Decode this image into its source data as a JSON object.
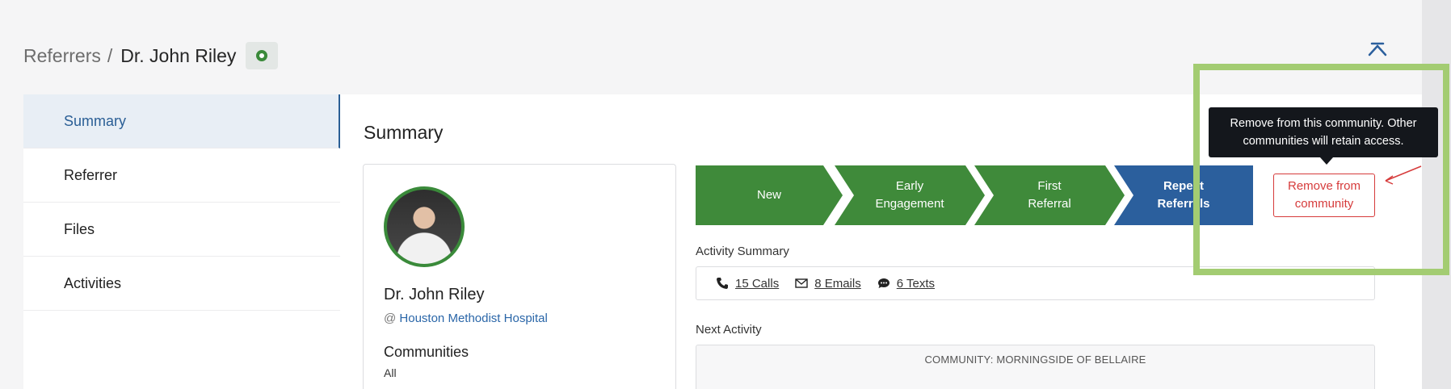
{
  "breadcrumb": {
    "parent": "Referrers",
    "separator": "/",
    "current": "Dr. John Riley"
  },
  "status": {
    "color": "#3a8a3a"
  },
  "sidebar": {
    "items": [
      {
        "label": "Summary",
        "active": true
      },
      {
        "label": "Referrer"
      },
      {
        "label": "Files"
      },
      {
        "label": "Activities"
      }
    ]
  },
  "main": {
    "title": "Summary"
  },
  "profile": {
    "name": "Dr. John Riley",
    "org_prefix": "@",
    "org": "Houston Methodist Hospital",
    "communities_label": "Communities",
    "communities_value": "All"
  },
  "stages": [
    {
      "label": "New",
      "state": "done"
    },
    {
      "label": "Early\nEngagement",
      "state": "done"
    },
    {
      "label": "First\nReferral",
      "state": "done"
    },
    {
      "label": "Repeat\nReferrals",
      "state": "current"
    }
  ],
  "remove_button": {
    "label": "Remove from community"
  },
  "tooltip": {
    "text": "Remove from this community. Other communities will retain access."
  },
  "activity": {
    "label": "Activity Summary",
    "calls": "15 Calls",
    "emails": "8 Emails",
    "texts": "6 Texts"
  },
  "next_activity": {
    "label": "Next Activity",
    "community": "COMMUNITY: MORNINGSIDE OF BELLAIRE"
  },
  "colors": {
    "accent": "#2b5f9d",
    "success": "#3f8a3a",
    "danger": "#d63b3b",
    "highlight": "#a3cc72"
  }
}
